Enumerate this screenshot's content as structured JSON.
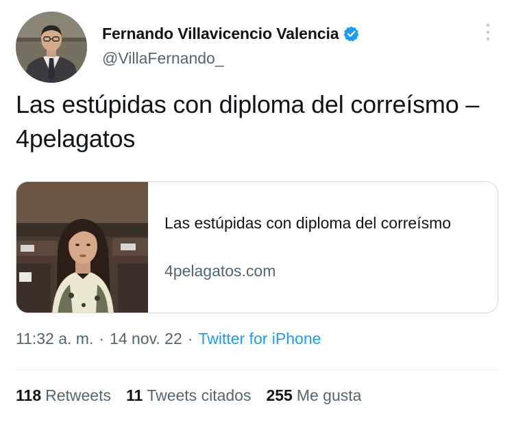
{
  "author": {
    "display_name": "Fernando Villavicencio Valencia",
    "handle": "@VillaFernando_",
    "verified": true,
    "avatar_icon": "profile-photo"
  },
  "tweet": {
    "text": "Las estúpidas con diploma del correísmo – 4pelagatos"
  },
  "link_card": {
    "title": "Las estúpidas con diploma del correísmo",
    "domain": "4pelagatos.com",
    "thumbnail_icon": "article-photo"
  },
  "meta": {
    "time": "11:32 a. m.",
    "separator": "·",
    "date": "14 nov. 22",
    "source": "Twitter for iPhone"
  },
  "stats": {
    "retweets_count": "118",
    "retweets_label": "Retweets",
    "quotes_count": "11",
    "quotes_label": "Tweets citados",
    "likes_count": "255",
    "likes_label": "Me gusta"
  },
  "colors": {
    "text_primary": "#0f1419",
    "text_secondary": "#536471",
    "accent": "#1d9bf0",
    "border": "#cfd9de"
  }
}
